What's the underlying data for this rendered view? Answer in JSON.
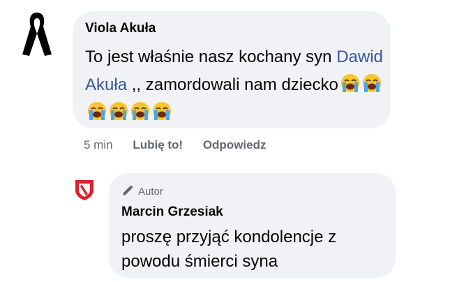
{
  "comment": {
    "author": "Viola Akuła",
    "text_before": "To jest właśnie nasz kochany syn ",
    "mention": "Dawid Akuła",
    "text_after": " ,, zamordowali nam dziecko",
    "emoji_icon": "loudly-crying-face-icon",
    "emoji_count": 6,
    "time": "5 min",
    "like_label": "Lubię to!",
    "reply_label": "Odpowiedz"
  },
  "reply": {
    "badge_icon": "pencil-icon",
    "badge_label": "Autor",
    "author": "Marcin Grzesiak",
    "text": "proszę przyjąć kondolencje z powodu śmierci syna"
  },
  "colors": {
    "bubble": "#f0f2f5",
    "mention": "#385898",
    "secondary_text": "#65676b"
  }
}
